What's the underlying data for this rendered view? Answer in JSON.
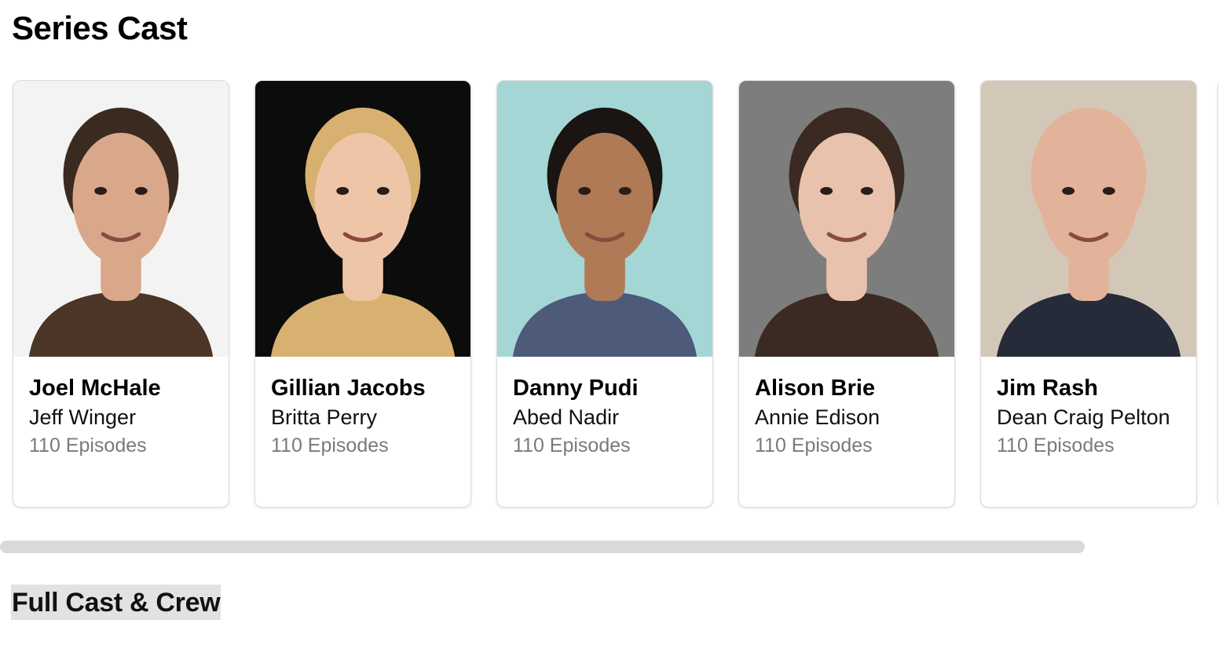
{
  "section": {
    "title": "Series Cast"
  },
  "cast": [
    {
      "name": "Joel McHale",
      "role": "Jeff Winger",
      "episodes": "110 Episodes",
      "photo_bg": "#f3f3f3",
      "skin": "#d9a88a",
      "hair": "#3b2a20",
      "shirt": "#4a3526"
    },
    {
      "name": "Gillian Jacobs",
      "role": "Britta Perry",
      "episodes": "110 Episodes",
      "photo_bg": "#0c0c0c",
      "skin": "#efc5a7",
      "hair": "#d8b070",
      "shirt": "#d8b070"
    },
    {
      "name": "Danny Pudi",
      "role": "Abed Nadir",
      "episodes": "110 Episodes",
      "photo_bg": "#a4d6d6",
      "skin": "#b07a56",
      "hair": "#1a1412",
      "shirt": "#4d5a7a"
    },
    {
      "name": "Alison Brie",
      "role": "Annie Edison",
      "episodes": "110 Episodes",
      "photo_bg": "#7d7d7d",
      "skin": "#e8c2ad",
      "hair": "#3a2a22",
      "shirt": "#3a2a22"
    },
    {
      "name": "Jim Rash",
      "role": "Dean Craig Pelton",
      "episodes": "110 Episodes",
      "photo_bg": "#d3c8b8",
      "skin": "#e2b39a",
      "hair": "#e2b39a",
      "shirt": "#262b3a"
    }
  ],
  "full_cast_link": {
    "label": "Full Cast & Crew"
  }
}
